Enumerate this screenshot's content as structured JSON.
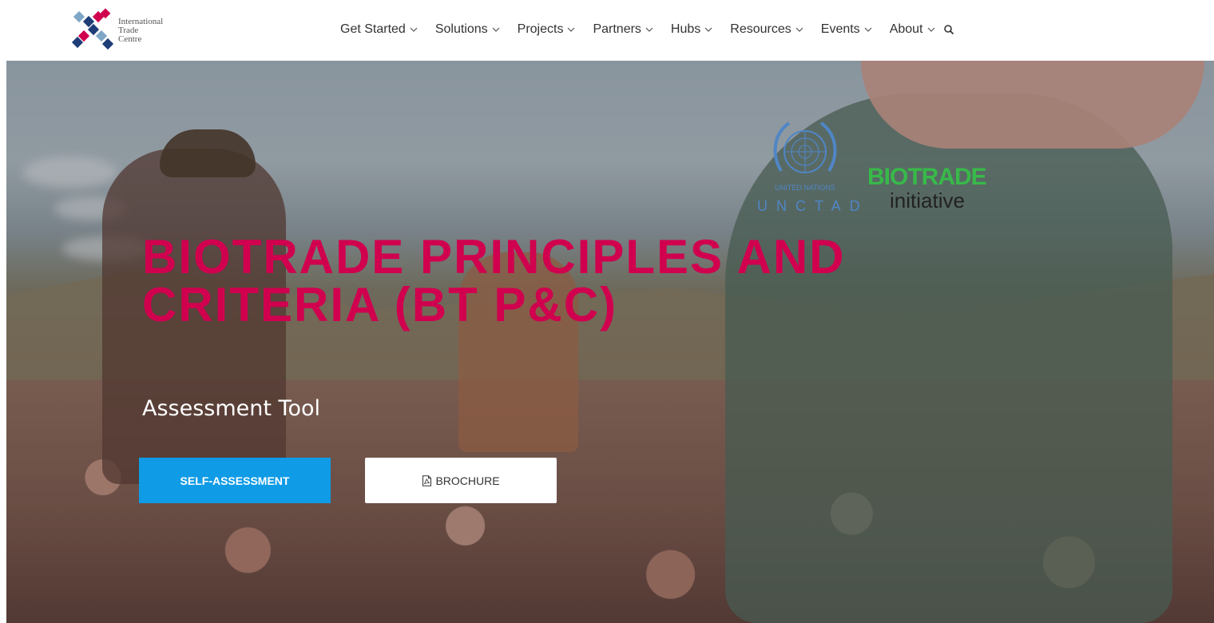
{
  "header": {
    "logo": {
      "line1": "International",
      "line2": "Trade",
      "line3": "Centre",
      "colors": [
        "#1e3c78",
        "#d0004f",
        "#7ea6c7"
      ]
    },
    "nav": [
      {
        "label": "Get Started"
      },
      {
        "label": "Solutions"
      },
      {
        "label": "Projects"
      },
      {
        "label": "Partners"
      },
      {
        "label": "Hubs"
      },
      {
        "label": "Resources"
      },
      {
        "label": "Events"
      },
      {
        "label": "About"
      }
    ],
    "search_icon": "search-icon"
  },
  "hero": {
    "partners": {
      "un_line1": "UNITED NATIONS",
      "un_line2": "UNCTAD",
      "biotrade_word": "BIOTRADE",
      "biotrade_sub": "initiative"
    },
    "title_line1": "BIOTRADE PRINCIPLES AND",
    "title_line2": "CRITERIA (BT P&C)",
    "subtitle": "Assessment Tool",
    "buttons": {
      "primary_label": "SELF-ASSESSMENT",
      "secondary_label": "BROCHURE",
      "secondary_icon": "pdf-icon"
    }
  },
  "colors": {
    "accent_title": "#d0004f",
    "primary_button": "#0f9be6",
    "un_blue": "#4f86c6",
    "biotrade_green": "#38b94a"
  }
}
